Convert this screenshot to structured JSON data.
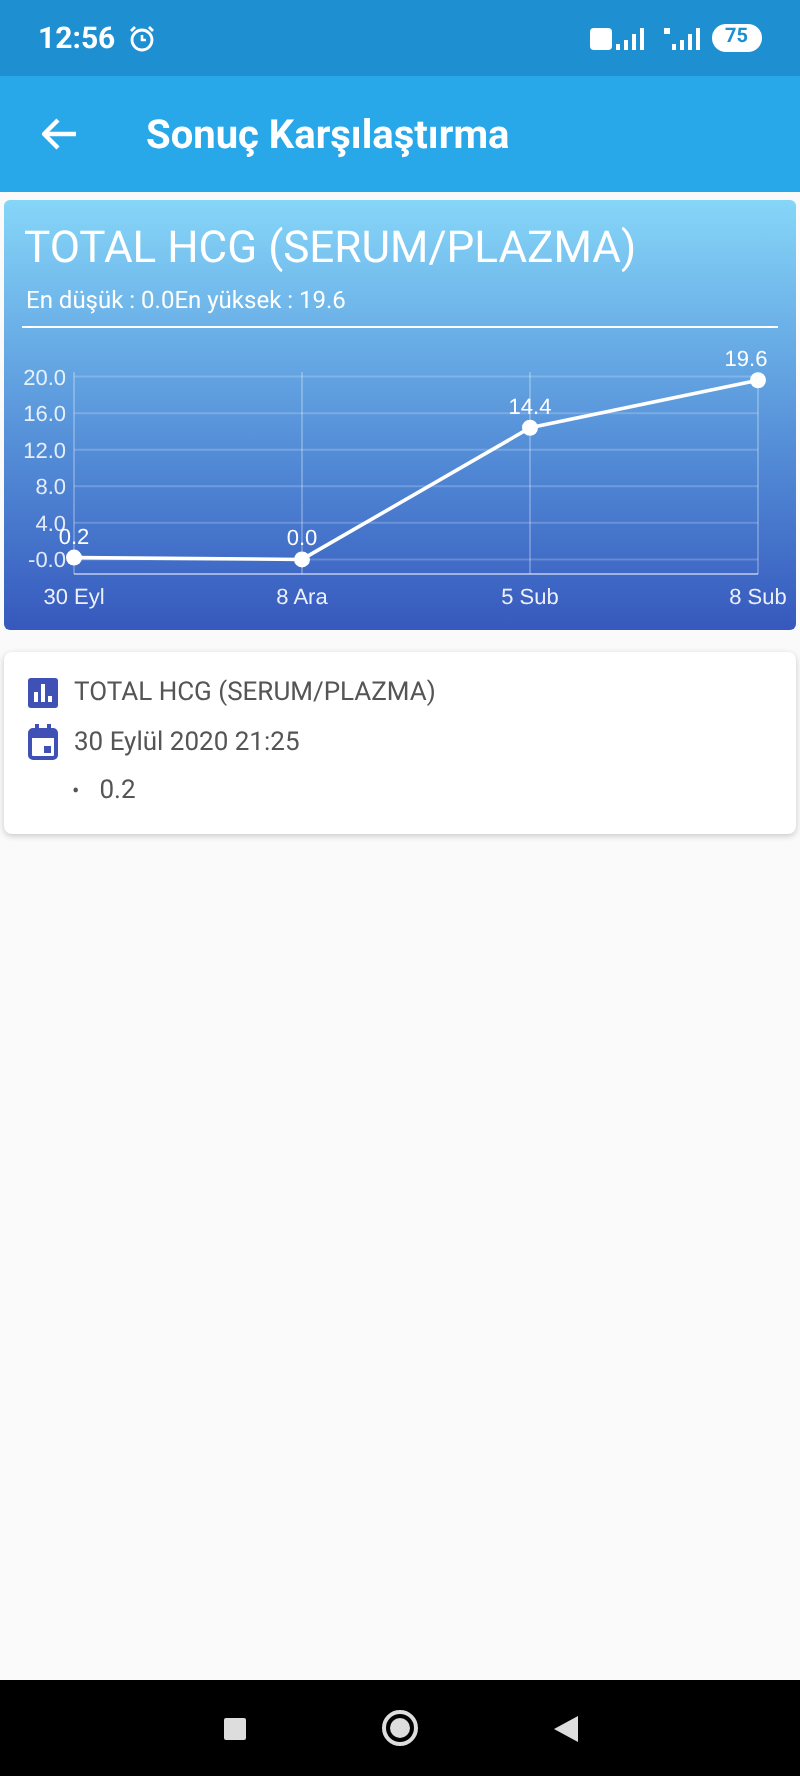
{
  "status_bar": {
    "time": "12:56",
    "battery": "75"
  },
  "app_bar": {
    "title": "Sonuç Karşılaştırma"
  },
  "chart_card": {
    "title": "TOTAL HCG (SERUM/PLAZMA)",
    "subtitle": "En düşük : 0.0En yüksek : 19.6",
    "chart_data": {
      "type": "line",
      "categories": [
        "30 Eyl",
        "8 Ara",
        "5 Sub",
        "8 Sub"
      ],
      "series": [
        {
          "color": "#ffffff",
          "values": [
            0.2,
            0.0,
            14.4,
            19.6
          ],
          "marker": true
        }
      ],
      "grid": true,
      "ylim": [
        -0.5,
        20.5
      ],
      "yticks": [
        {
          "value": 0,
          "label": "-0.0"
        },
        {
          "value": 4,
          "label": "4.0"
        },
        {
          "value": 8,
          "label": "8.0"
        },
        {
          "value": 12,
          "label": "12.0"
        },
        {
          "value": 16,
          "label": "16.0"
        },
        {
          "value": 20,
          "label": "20.0"
        }
      ],
      "value_labels": [
        "0.2",
        "0.0",
        "14.4",
        "19.6"
      ]
    }
  },
  "detail_card": {
    "test_name": "TOTAL HCG (SERUM/PLAZMA)",
    "date": "30 Eylül 2020 21:25",
    "values": [
      {
        "bullet": "•",
        "value": "0.2"
      }
    ]
  }
}
